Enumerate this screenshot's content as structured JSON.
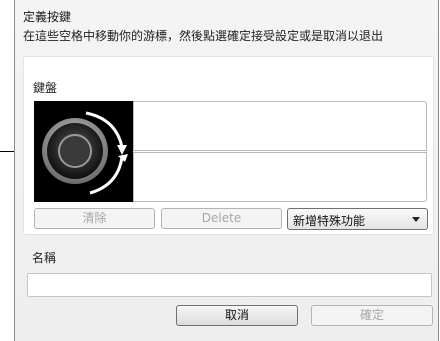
{
  "dialog": {
    "title": "定義按鍵",
    "instruction": "在這些空格中移動你的游標，然後點選確定接受設定或是取消以退出"
  },
  "keys_section": {
    "label": "鍵盤",
    "clear_label": "清除",
    "delete_label": "Delete",
    "special_function": {
      "selected": "新增特殊功能"
    }
  },
  "name_section": {
    "label": "名稱",
    "value": ""
  },
  "footer": {
    "cancel_label": "取消",
    "ok_label": "確定"
  },
  "icons": {
    "preview": "dial-rotate-icon",
    "dropdown": "chevron-down-icon"
  }
}
